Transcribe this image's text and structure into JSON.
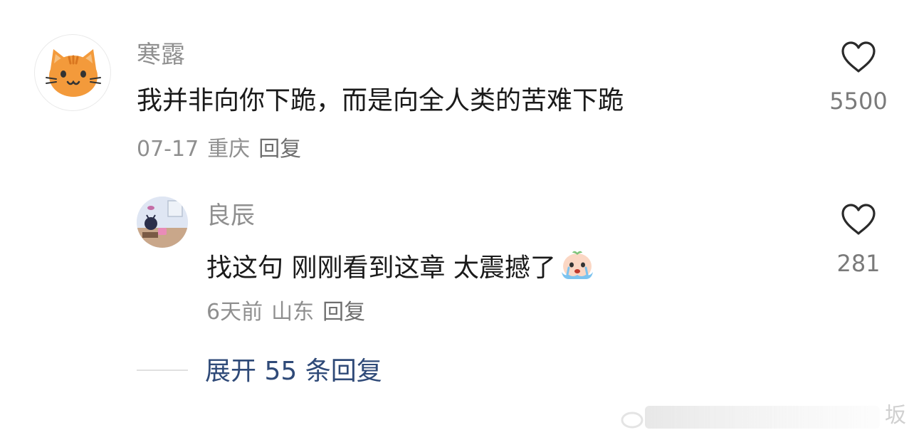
{
  "comment": {
    "username": "寒露",
    "text": "我并非向你下跪，而是向全人类的苦难下跪",
    "date": "07-17",
    "location": "重庆",
    "reply_label": "回复",
    "likes": "5500"
  },
  "reply": {
    "username": "良辰",
    "text": "找这句 刚刚看到这章 太震撼了",
    "date": "6天前",
    "location": "山东",
    "reply_label": "回复",
    "likes": "281"
  },
  "expand_replies": {
    "label": "展开 55 条回复"
  },
  "watermark": {
    "text": "坂"
  },
  "colors": {
    "username": "#8f8f8f",
    "text": "#1a1a1a",
    "expand_link": "#2f4a78",
    "avatar_cat": "#f39a3b"
  }
}
